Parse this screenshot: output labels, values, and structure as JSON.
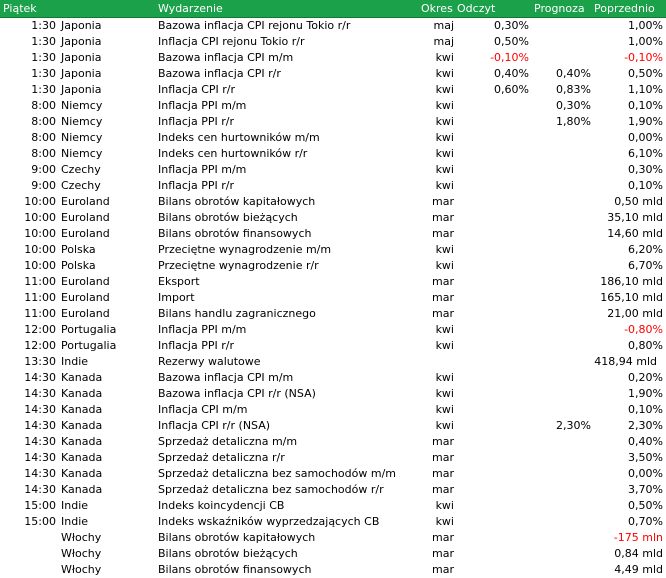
{
  "header": {
    "day": "Piątek",
    "event": "Wydarzenie",
    "period": "Okres",
    "actual": "Odczyt",
    "forecast": "Prognoza",
    "previous": "Poprzednio"
  },
  "colors": {
    "header_bg": "#1aa14a",
    "header_text": "#ffffff",
    "negative": "#ff0000"
  },
  "rows": [
    {
      "time": "1:30",
      "country": "Japonia",
      "event": "Bazowa inflacja CPI rejonu Tokio r/r",
      "period": "maj",
      "actual": "0,30%",
      "forecast": "",
      "previous": "1,00%"
    },
    {
      "time": "1:30",
      "country": "Japonia",
      "event": "Inflacja CPI rejonu Tokio r/r",
      "period": "maj",
      "actual": "0,50%",
      "forecast": "",
      "previous": "1,00%"
    },
    {
      "time": "1:30",
      "country": "Japonia",
      "event": "Bazowa inflacja CPI m/m",
      "period": "kwi",
      "actual": "-0,10%",
      "forecast": "",
      "previous": "-0,10%"
    },
    {
      "time": "1:30",
      "country": "Japonia",
      "event": "Bazowa inflacja CPI r/r",
      "period": "kwi",
      "actual": "0,40%",
      "forecast": "0,40%",
      "previous": "0,50%"
    },
    {
      "time": "1:30",
      "country": "Japonia",
      "event": "Inflacja CPI r/r",
      "period": "kwi",
      "actual": "0,60%",
      "forecast": "0,83%",
      "previous": "1,10%"
    },
    {
      "time": "8:00",
      "country": "Niemcy",
      "event": "Inflacja PPI m/m",
      "period": "kwi",
      "actual": "",
      "forecast": "0,30%",
      "previous": "0,10%"
    },
    {
      "time": "8:00",
      "country": "Niemcy",
      "event": "Inflacja PPI r/r",
      "period": "kwi",
      "actual": "",
      "forecast": "1,80%",
      "previous": "1,90%"
    },
    {
      "time": "8:00",
      "country": "Niemcy",
      "event": "Indeks cen hurtowników m/m",
      "period": "kwi",
      "actual": "",
      "forecast": "",
      "previous": "0,00%"
    },
    {
      "time": "8:00",
      "country": "Niemcy",
      "event": "Indeks cen hurtowników r/r",
      "period": "kwi",
      "actual": "",
      "forecast": "",
      "previous": "6,10%"
    },
    {
      "time": "9:00",
      "country": "Czechy",
      "event": "Inflacja PPI m/m",
      "period": "kwi",
      "actual": "",
      "forecast": "",
      "previous": "0,30%"
    },
    {
      "time": "9:00",
      "country": "Czechy",
      "event": "Inflacja PPI r/r",
      "period": "kwi",
      "actual": "",
      "forecast": "",
      "previous": "0,10%"
    },
    {
      "time": "10:00",
      "country": "Euroland",
      "event": "Bilans obrotów kapitałowych",
      "period": "mar",
      "actual": "",
      "forecast": "",
      "previous": "0,50 mld"
    },
    {
      "time": "10:00",
      "country": "Euroland",
      "event": "Bilans obrotów bieżących",
      "period": "mar",
      "actual": "",
      "forecast": "",
      "previous": "35,10 mld"
    },
    {
      "time": "10:00",
      "country": "Euroland",
      "event": "Bilans obrotów finansowych",
      "period": "mar",
      "actual": "",
      "forecast": "",
      "previous": "14,60 mld"
    },
    {
      "time": "10:00",
      "country": "Polska",
      "event": "Przeciętne wynagrodzenie m/m",
      "period": "kwi",
      "actual": "",
      "forecast": "",
      "previous": "6,20%"
    },
    {
      "time": "10:00",
      "country": "Polska",
      "event": "Przeciętne wynagrodzenie r/r",
      "period": "kwi",
      "actual": "",
      "forecast": "",
      "previous": "6,70%"
    },
    {
      "time": "11:00",
      "country": "Euroland",
      "event": "Eksport",
      "period": "mar",
      "actual": "",
      "forecast": "",
      "previous": "186,10 mld"
    },
    {
      "time": "11:00",
      "country": "Euroland",
      "event": "Import",
      "period": "mar",
      "actual": "",
      "forecast": "",
      "previous": "165,10 mld"
    },
    {
      "time": "11:00",
      "country": "Euroland",
      "event": "Bilans handlu zagranicznego",
      "period": "mar",
      "actual": "",
      "forecast": "",
      "previous": "21,00 mld"
    },
    {
      "time": "12:00",
      "country": "Portugalia",
      "event": "Inflacja PPI m/m",
      "period": "kwi",
      "actual": "",
      "forecast": "",
      "previous": "-0,80%"
    },
    {
      "time": "12:00",
      "country": "Portugalia",
      "event": "Inflacja PPI r/r",
      "period": "kwi",
      "actual": "",
      "forecast": "",
      "previous": "0,80%"
    },
    {
      "time": "13:30",
      "country": "Indie",
      "event": "Rezerwy walutowe",
      "period": "",
      "actual": "",
      "forecast": "",
      "previous": "418,94 mld"
    },
    {
      "time": "14:30",
      "country": "Kanada",
      "event": "Bazowa inflacja CPI m/m",
      "period": "kwi",
      "actual": "",
      "forecast": "",
      "previous": "0,20%"
    },
    {
      "time": "14:30",
      "country": "Kanada",
      "event": "Bazowa inflacja CPI r/r (NSA)",
      "period": "kwi",
      "actual": "",
      "forecast": "",
      "previous": "1,90%"
    },
    {
      "time": "14:30",
      "country": "Kanada",
      "event": "Inflacja CPI m/m",
      "period": "kwi",
      "actual": "",
      "forecast": "",
      "previous": "0,10%"
    },
    {
      "time": "14:30",
      "country": "Kanada",
      "event": "Inflacja CPI r/r (NSA)",
      "period": "kwi",
      "actual": "",
      "forecast": "2,30%",
      "previous": "2,30%"
    },
    {
      "time": "14:30",
      "country": "Kanada",
      "event": "Sprzedaż detaliczna m/m",
      "period": "mar",
      "actual": "",
      "forecast": "",
      "previous": "0,40%"
    },
    {
      "time": "14:30",
      "country": "Kanada",
      "event": "Sprzedaż detaliczna r/r",
      "period": "mar",
      "actual": "",
      "forecast": "",
      "previous": "3,50%"
    },
    {
      "time": "14:30",
      "country": "Kanada",
      "event": "Sprzedaż detaliczna bez samochodów m/m",
      "period": "mar",
      "actual": "",
      "forecast": "",
      "previous": "0,00%"
    },
    {
      "time": "14:30",
      "country": "Kanada",
      "event": "Sprzedaż detaliczna bez samochodów r/r",
      "period": "mar",
      "actual": "",
      "forecast": "",
      "previous": "3,70%"
    },
    {
      "time": "15:00",
      "country": "Indie",
      "event": "Indeks koincydencji CB",
      "period": "kwi",
      "actual": "",
      "forecast": "",
      "previous": "0,50%"
    },
    {
      "time": "15:00",
      "country": "Indie",
      "event": "Indeks wskaźników wyprzedzających CB",
      "period": "kwi",
      "actual": "",
      "forecast": "",
      "previous": "0,70%"
    },
    {
      "time": "",
      "country": "Włochy",
      "event": "Bilans obrotów kapitałowych",
      "period": "mar",
      "actual": "",
      "forecast": "",
      "previous": "-175 mln"
    },
    {
      "time": "",
      "country": "Włochy",
      "event": "Bilans obrotów bieżących",
      "period": "mar",
      "actual": "",
      "forecast": "",
      "previous": "0,84 mld"
    },
    {
      "time": "",
      "country": "Włochy",
      "event": "Bilans obrotów finansowych",
      "period": "mar",
      "actual": "",
      "forecast": "",
      "previous": "4,49 mld"
    }
  ]
}
